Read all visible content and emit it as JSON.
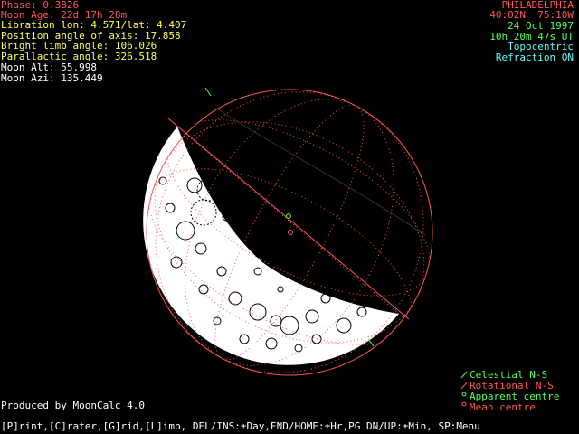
{
  "info": {
    "phase": "Phase: 0.3826",
    "moon_age": "Moon Age: 22d 17h 28m",
    "libration": "Libration lon: 4.571/lat: 4.407",
    "position_angle": "Position angle of axis: 17.858",
    "bright_limb": "Bright limb angle: 106.026",
    "parallactic": "Parallactic angle: 326.518",
    "moon_alt": "Moon Alt: 55.998",
    "moon_azi": "Moon Azi: 135.449"
  },
  "location": {
    "city": "PHILADELPHIA",
    "coords": "40:02N  75:10W",
    "date": "24 Oct 1997",
    "time": "10h 20m 47s UT",
    "mode": "Topocentric",
    "refraction": "Refraction ON"
  },
  "legend": {
    "celestial": "Celestial N-S",
    "rotational": "Rotational N-S",
    "apparent": "Apparent centre",
    "mean": "Mean centre"
  },
  "credit": "Produced by MoonCalc 4.0",
  "menu": "[P]rint,[C]rater,[G]rid,[L]imb, DEL/INS:±Day,END/HOME:±Hr,PG DN/UP:±Min, SP:Menu",
  "colors": {
    "info_text": "#ffff55",
    "phase_text": "#ff5555",
    "city_text": "#ff5555",
    "date_text": "#55ff55",
    "mode_text": "#55ffff",
    "grid": "#ff5555",
    "lit": "#ffffff",
    "terminator": "#ff5555",
    "celestial_marker": "#55ff55",
    "apparent_marker": "#55ff55",
    "mean_marker": "#ff5555"
  },
  "moon": {
    "phase_fraction": 0.3826,
    "position_angle_deg": 17.858,
    "bright_limb_deg": 106.026
  }
}
